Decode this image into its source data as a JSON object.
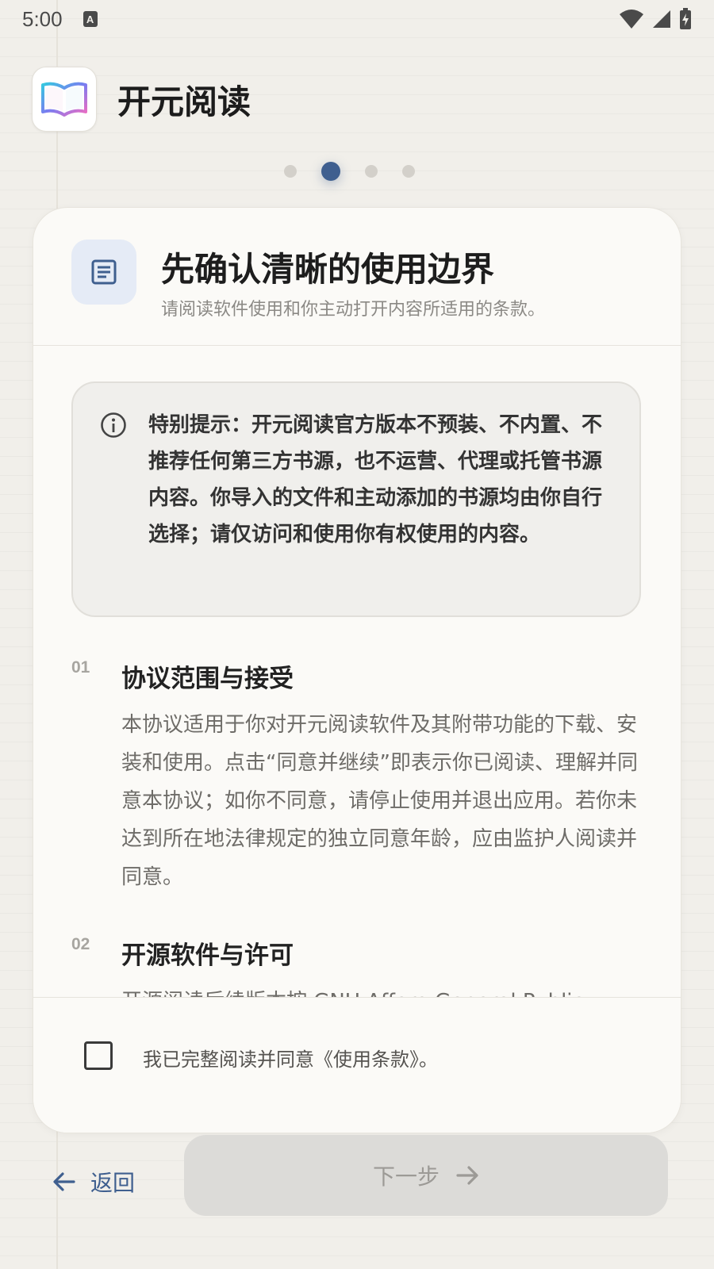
{
  "status_bar": {
    "time": "5:00",
    "notification_glyph": "A",
    "icons": [
      "wifi-icon",
      "signal-icon",
      "battery-charging-icon"
    ]
  },
  "app": {
    "name": "开元阅读",
    "logo_icon": "open-book-icon"
  },
  "pager": {
    "total": 4,
    "active_index": 1
  },
  "card": {
    "icon": "document-list-icon",
    "title": "先确认清晰的使用边界",
    "subtitle": "请阅读软件使用和你主动打开内容所适用的条款。",
    "notice": {
      "icon": "info-icon",
      "text": "特别提示：开元阅读官方版本不预装、不内置、不推荐任何第三方书源，也不运营、代理或托管书源内容。你导入的文件和主动添加的书源均由你自行选择；请仅访问和使用你有权使用的内容。"
    },
    "sections": [
      {
        "number": "01",
        "title": "协议范围与接受",
        "body": "本协议适用于你对开元阅读软件及其附带功能的下载、安装和使用。点击“同意并继续”即表示你已阅读、理解并同意本协议；如你不同意，请停止使用并退出应用。若你未达到所在地法律规定的独立同意年龄，应由监护人阅读并同意。"
      },
      {
        "number": "02",
        "title": "开源软件与许可",
        "body": "开源阅读后续版本按 GNU Affero General Public"
      }
    ],
    "agreement": {
      "checked": false,
      "label": "我已完整阅读并同意《使用条款》。"
    }
  },
  "footer": {
    "back_label": "返回",
    "next_label": "下一步",
    "next_enabled": false
  },
  "colors": {
    "accent": "#3f5f8f",
    "background": "#f1efea",
    "card": "#fbfaf7",
    "disabled_button": "#dcdbd8"
  }
}
